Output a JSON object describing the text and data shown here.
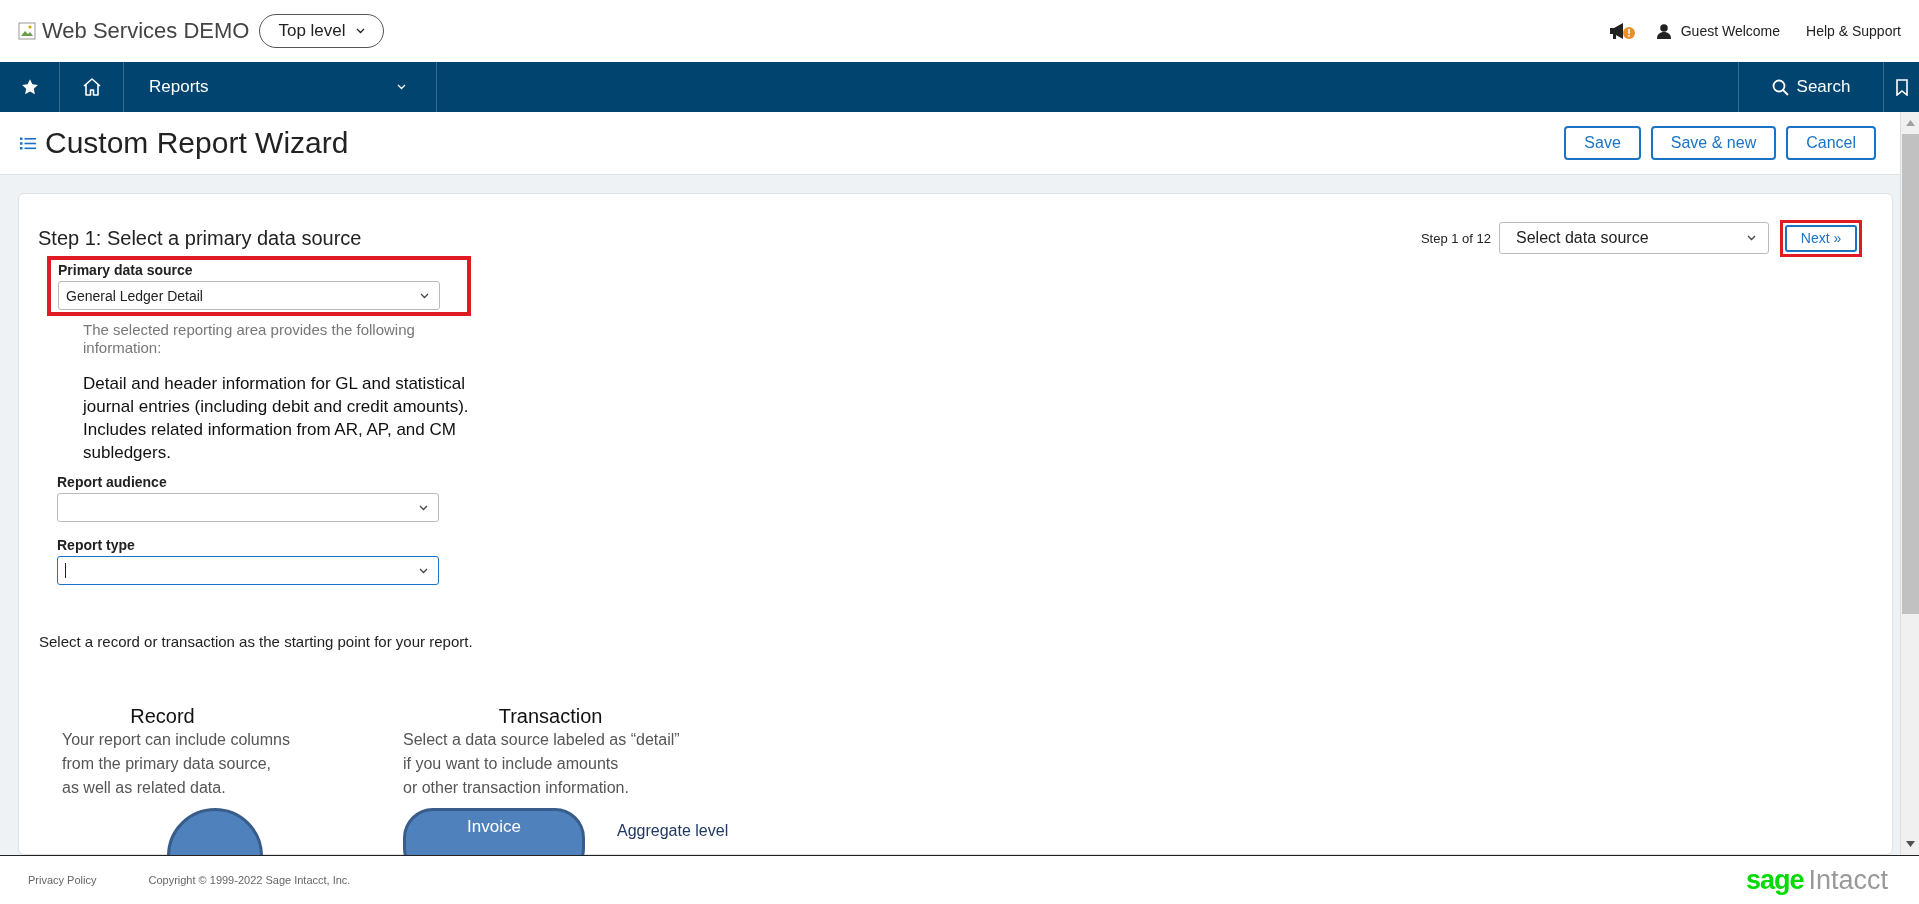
{
  "topbar": {
    "title": "Web Services DEMO",
    "level_menu": "Top level",
    "user": "Guest Welcome",
    "help": "Help & Support"
  },
  "nav": {
    "menu": "Reports",
    "search": "Search"
  },
  "page": {
    "title": "Custom Report Wizard",
    "buttons": [
      "Save",
      "Save & new",
      "Cancel"
    ]
  },
  "wizard": {
    "step_title": "Step 1: Select a primary data source",
    "step_counter": "Step 1 of 12",
    "step_select": "Select data source",
    "next": {
      "label": "Next »",
      "highlighted": true
    },
    "primary_source": {
      "label": "Primary data source",
      "value": "General Ledger Detail",
      "highlighted": true
    },
    "info_intro": "The selected reporting area provides the following information:",
    "info_text": "Detail and header information for GL and statistical journal entries (including debit and credit amounts). Includes related information from AR, AP, and CM subledgers.",
    "fields": [
      {
        "label": "Report audience",
        "focused": false
      },
      {
        "label": "Report type",
        "focused": true
      }
    ],
    "instruction": "Select a record or transaction as the starting point for your report.",
    "diagram": [
      {
        "kind": "circle",
        "title": "Record",
        "lines": [
          "Your report can include columns",
          "from the primary data source,",
          "as well as related data."
        ]
      },
      {
        "kind": "pill",
        "title": "Transaction",
        "lines": [
          "Select a data source labeled as “detail”",
          "if you want to include amounts",
          "or other transaction information."
        ],
        "shape_label": "Invoice",
        "side_label": "Aggregate level"
      }
    ]
  },
  "footer": {
    "privacy": "Privacy Policy",
    "copyright": "Copyright © 1999-2022 Sage Intacct, Inc.",
    "logo": [
      "sage",
      "Intacct"
    ]
  }
}
